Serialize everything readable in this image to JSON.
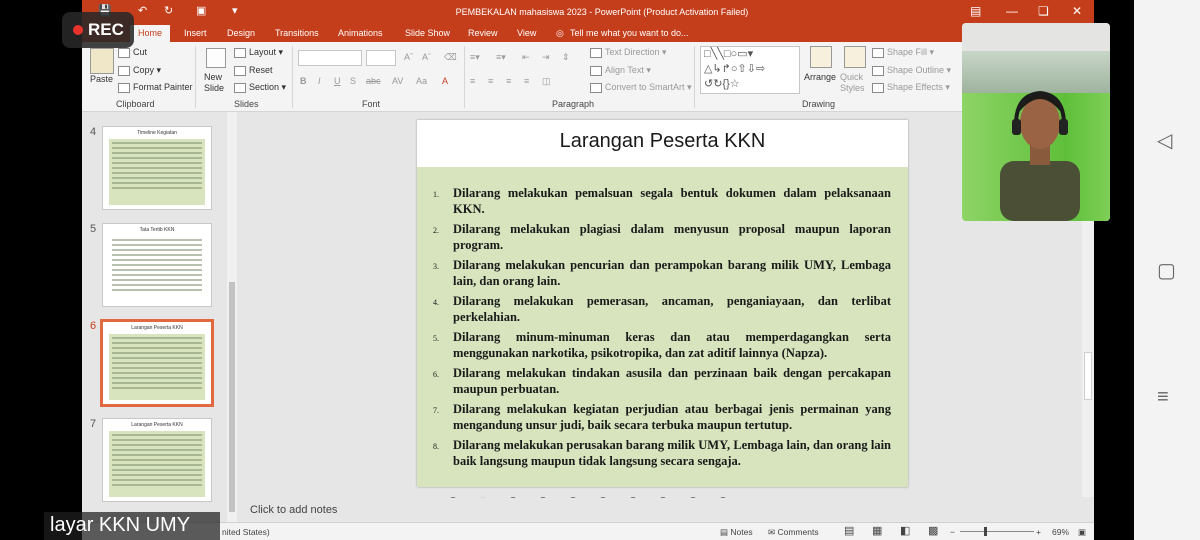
{
  "rec_label": "REC",
  "caption": "layar KKN UMY",
  "window": {
    "title": "PEMBEKALAN mahasiswa 2023 - PowerPoint (Product Activation Failed)",
    "brand_color": "#c43e1c"
  },
  "tabs": [
    "Home",
    "Insert",
    "Design",
    "Transitions",
    "Animations",
    "Slide Show",
    "Review",
    "View"
  ],
  "tell_me": "Tell me what you want to do...",
  "ribbon": {
    "clipboard": {
      "label": "Clipboard",
      "paste": "Paste",
      "cut": "Cut",
      "copy": "Copy",
      "format_painter": "Format Painter"
    },
    "slides": {
      "label": "Slides",
      "new_slide": "New Slide",
      "layout": "Layout",
      "reset": "Reset",
      "section": "Section"
    },
    "font": {
      "label": "Font",
      "bold": "B",
      "italic": "I",
      "underline": "U",
      "strike": "S",
      "abc": "abc"
    },
    "paragraph": {
      "label": "Paragraph",
      "text_direction": "Text Direction",
      "align_text": "Align Text",
      "convert": "Convert to SmartArt"
    },
    "drawing": {
      "label": "Drawing",
      "arrange": "Arrange",
      "quick_styles": "Quick Styles",
      "shape_fill": "Shape Fill",
      "shape_outline": "Shape Outline",
      "shape_effects": "Shape Effects"
    }
  },
  "thumbnails": [
    {
      "num": "4",
      "title": "Timeline Kegiatan"
    },
    {
      "num": "5",
      "title": "Tata Tertib KKN"
    },
    {
      "num": "6",
      "title": "Larangan Peserta KKN",
      "active": true
    },
    {
      "num": "7",
      "title": "Larangan Peserta KKN"
    }
  ],
  "slide": {
    "title": "Larangan Peserta KKN",
    "items": [
      {
        "n": "1.",
        "text": "Dilarang melakukan pemalsuan segala bentuk dokumen dalam pelaksanaan KKN."
      },
      {
        "n": "2.",
        "text": "Dilarang melakukan plagiasi dalam menyusun proposal maupun laporan program."
      },
      {
        "n": "3.",
        "text": "Dilarang melakukan pencurian dan perampokan barang milik UMY, Lembaga lain, dan orang lain."
      },
      {
        "n": "4.",
        "text": "Dilarang melakukan pemerasan, ancaman, penganiayaan, dan terlibat perkelahian."
      },
      {
        "n": "5.",
        "text": "Dilarang minum-minuman keras dan atau memperdagangkan serta menggunakan narkotika, psikotropika, dan zat aditif lainnya (Napza)."
      },
      {
        "n": "6.",
        "text": "Dilarang melakukan tindakan asusila dan perzinaan baik dengan percakapan maupun perbuatan."
      },
      {
        "n": "7.",
        "text": "Dilarang melakukan kegiatan perjudian atau berbagai jenis permainan yang mengandung unsur judi, baik secara terbuka maupun tertutup."
      },
      {
        "n": "8.",
        "text": "Dilarang melakukan perusakan barang milik UMY, Lembaga lain, dan orang lain baik langsung maupun tidak langsung secara sengaja."
      }
    ]
  },
  "notes_placeholder": "Click to add notes",
  "status": {
    "language": "nited States)",
    "notes": "Notes",
    "comments": "Comments",
    "zoom": "69%"
  }
}
